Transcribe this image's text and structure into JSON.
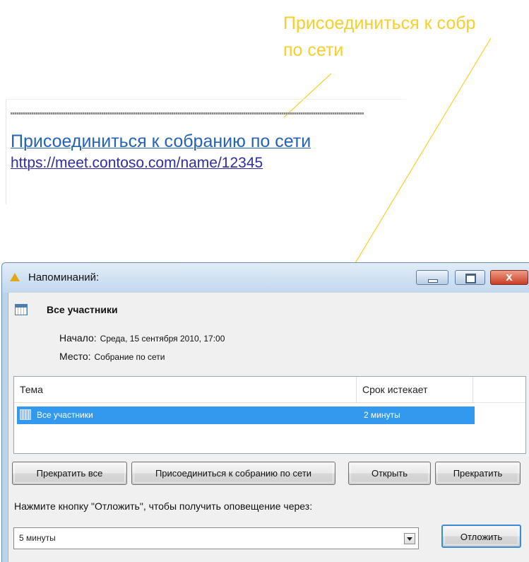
{
  "callout": {
    "text": "Присоединиться  к собр\nпо сети"
  },
  "invite": {
    "link_title": "Присоединиться к собранию по сети",
    "link_url": "https://meet.contoso.com/name/12345"
  },
  "window": {
    "title": "Напоминаний:",
    "subject": "Все участники",
    "start_label": "Начало:",
    "start_value": "Среда, 15 сентября 2010, 17:00",
    "location_label": "Место:",
    "location_value": "Собрание по сети",
    "close_glyph": "x"
  },
  "reminder_list": {
    "columns": [
      "Тема",
      "Срок истекает"
    ],
    "rows": [
      {
        "subject": "Все участники",
        "due": "2 минуты",
        "selected": true
      }
    ]
  },
  "buttons": {
    "dismiss_all": "Прекратить все",
    "join_online": "Присоединиться к собранию по сети",
    "open": "Открыть",
    "dismiss": "Прекратить",
    "snooze": "Отложить"
  },
  "snooze": {
    "prompt": "Нажмите кнопку \"Отложить\", чтобы получить оповещение через:",
    "selected_interval": "5 минуты"
  },
  "colors": {
    "callout": "#f5cf2b",
    "link": "#2563b8",
    "selection": "#3399ee"
  }
}
